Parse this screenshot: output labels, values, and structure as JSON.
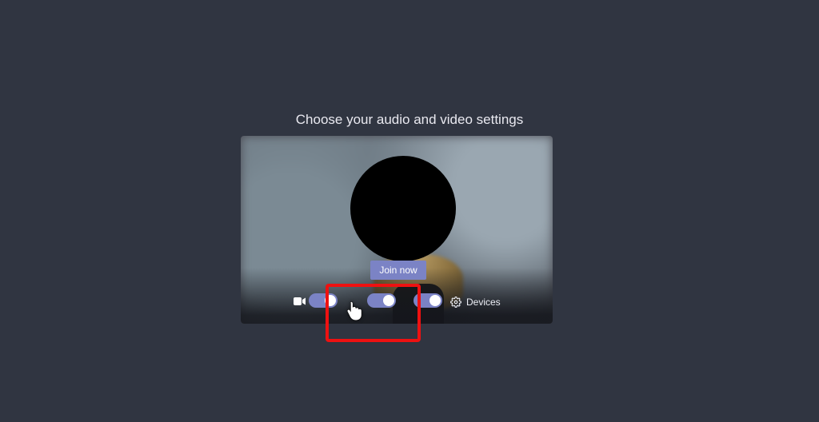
{
  "heading": "Choose your audio and video settings",
  "join_button": {
    "label": "Join now"
  },
  "controls": {
    "video_toggle": "on",
    "blur_toggle": "on",
    "mic_toggle": "on"
  },
  "devices": {
    "label": "Devices"
  }
}
